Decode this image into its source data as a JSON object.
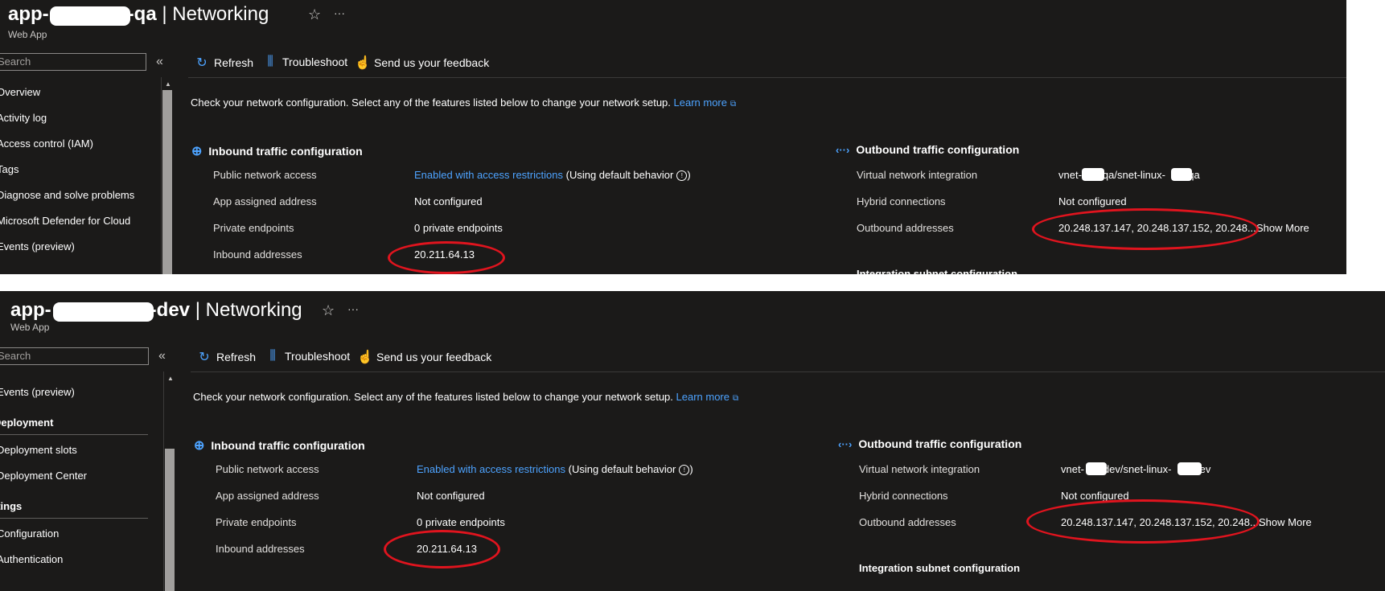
{
  "colors": {
    "panel_bg": "#1b1a19",
    "link": "#4da3ff",
    "annotation": "#e0141e"
  },
  "icons": {
    "star": "☆",
    "more": "···",
    "collapse": "«",
    "refresh": "↻",
    "troubleshoot": "⫼",
    "feedback": "☝",
    "inbound": "⊕",
    "outbound": "‹··›",
    "external": "⧉",
    "info": "!"
  },
  "panels": [
    {
      "title_prefix": "app-",
      "title_suffix": "-qa",
      "title_page": "| Networking",
      "subtitle": "Web App",
      "search_placeholder": "Search",
      "nav": [
        {
          "type": "item",
          "label": "Overview"
        },
        {
          "type": "item",
          "label": "Activity log"
        },
        {
          "type": "item",
          "label": "Access control (IAM)"
        },
        {
          "type": "item",
          "label": "Tags"
        },
        {
          "type": "item",
          "label": "Diagnose and solve problems"
        },
        {
          "type": "item",
          "label": "Microsoft Defender for Cloud"
        },
        {
          "type": "item",
          "label": "Events (preview)"
        }
      ],
      "toolbar": {
        "refresh": "Refresh",
        "troubleshoot": "Troubleshoot",
        "feedback": "Send us your feedback"
      },
      "description": "Check your network configuration. Select any of the features listed below to change your network setup.",
      "learn_more": "Learn more",
      "inbound": {
        "title": "Inbound traffic configuration",
        "public_network_access_label": "Public network access",
        "public_network_access_link": "Enabled with access restrictions",
        "public_network_access_note": "(Using default behavior",
        "app_assigned_label": "App assigned address",
        "app_assigned_value": "Not configured",
        "private_endpoints_label": "Private endpoints",
        "private_endpoints_value": "0 private endpoints",
        "inbound_addresses_label": "Inbound addresses",
        "inbound_addresses_value": "20.211.64.13"
      },
      "outbound": {
        "title": "Outbound traffic configuration",
        "vnet_label": "Virtual network integration",
        "vnet_prefix": "vnet-",
        "vnet_mid": "qa/snet-linux-",
        "vnet_suffix": "-qa",
        "hybrid_label": "Hybrid connections",
        "hybrid_value": "Not configured",
        "outbound_addresses_label": "Outbound addresses",
        "outbound_addresses_value": "20.248.137.147, 20.248.137.152, 20.248....",
        "show_more": "Show More",
        "cutoff_heading": "Integration subnet configuration"
      }
    },
    {
      "title_prefix": "app-",
      "title_suffix": "-dev",
      "title_page": "| Networking",
      "subtitle": "Web App",
      "search_placeholder": "Search",
      "nav": [
        {
          "type": "item",
          "label": "Events (preview)"
        },
        {
          "type": "section",
          "label": "Deployment"
        },
        {
          "type": "item",
          "label": "Deployment slots"
        },
        {
          "type": "item",
          "label": "Deployment Center"
        },
        {
          "type": "section",
          "label": "Settings"
        },
        {
          "type": "item",
          "label": "Configuration"
        },
        {
          "type": "item",
          "label": "Authentication"
        }
      ],
      "toolbar": {
        "refresh": "Refresh",
        "troubleshoot": "Troubleshoot",
        "feedback": "Send us your feedback"
      },
      "description": "Check your network configuration. Select any of the features listed below to change your network setup.",
      "learn_more": "Learn more",
      "inbound": {
        "title": "Inbound traffic configuration",
        "public_network_access_label": "Public network access",
        "public_network_access_link": "Enabled with access restrictions",
        "public_network_access_note": "(Using default behavior",
        "app_assigned_label": "App assigned address",
        "app_assigned_value": "Not configured",
        "private_endpoints_label": "Private endpoints",
        "private_endpoints_value": "0 private endpoints",
        "inbound_addresses_label": "Inbound addresses",
        "inbound_addresses_value": "20.211.64.13"
      },
      "outbound": {
        "title": "Outbound traffic configuration",
        "vnet_label": "Virtual network integration",
        "vnet_prefix": "vnet-",
        "vnet_mid": "dev/snet-linux-",
        "vnet_suffix": "dev",
        "hybrid_label": "Hybrid connections",
        "hybrid_value": "Not configured",
        "outbound_addresses_label": "Outbound addresses",
        "outbound_addresses_value": "20.248.137.147, 20.248.137.152, 20.248....",
        "show_more": "Show More",
        "cutoff_heading": "Integration subnet configuration"
      }
    }
  ]
}
